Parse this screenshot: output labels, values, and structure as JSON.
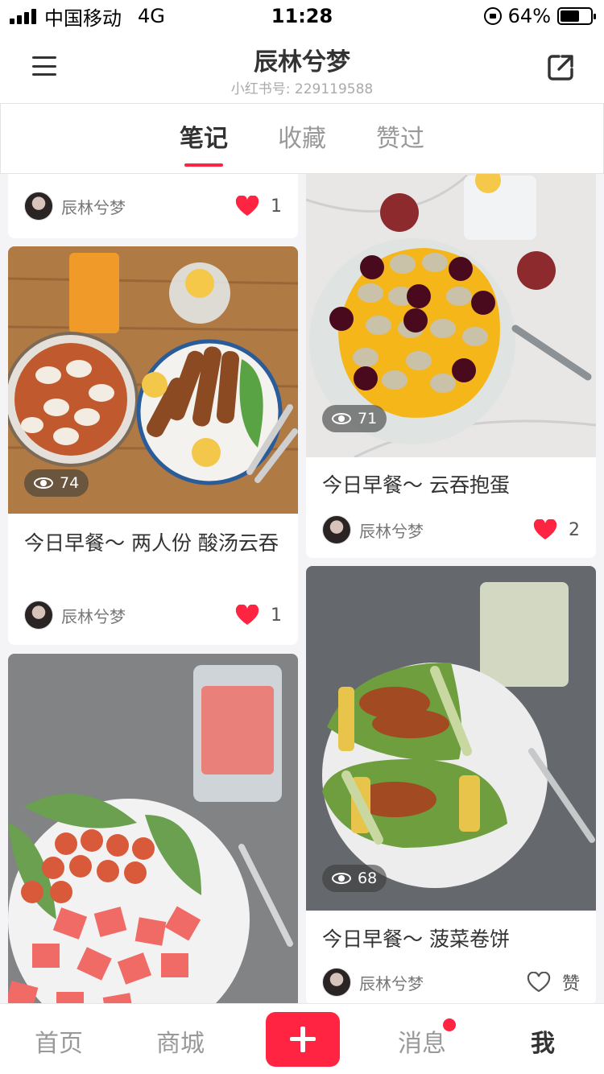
{
  "status_bar": {
    "carrier": "中国移动",
    "network": "4G",
    "time": "11:28",
    "battery": "64%"
  },
  "header": {
    "title": "辰林兮梦",
    "subtitle": "小红书号: 229119588"
  },
  "tabs": [
    {
      "label": "笔记"
    },
    {
      "label": "收藏"
    },
    {
      "label": "赞过"
    }
  ],
  "cards": [
    {
      "title": "",
      "author": "辰林兮梦",
      "likes": "1",
      "views": ""
    },
    {
      "title": "今日早餐～ 两人份 酸汤云吞",
      "author": "辰林兮梦",
      "likes": "1",
      "views": "74"
    },
    {
      "title": "",
      "author": "",
      "likes": "",
      "views": ""
    },
    {
      "title": "今日早餐～ 云吞抱蛋",
      "author": "辰林兮梦",
      "likes": "2",
      "views": "71"
    },
    {
      "title": "今日早餐～ 菠菜卷饼",
      "author": "辰林兮梦",
      "likes": "赞",
      "views": "68"
    }
  ],
  "bottom_nav": {
    "home": "首页",
    "mall": "商城",
    "messages": "消息",
    "me": "我"
  },
  "colors": {
    "accent": "#ff2442"
  }
}
